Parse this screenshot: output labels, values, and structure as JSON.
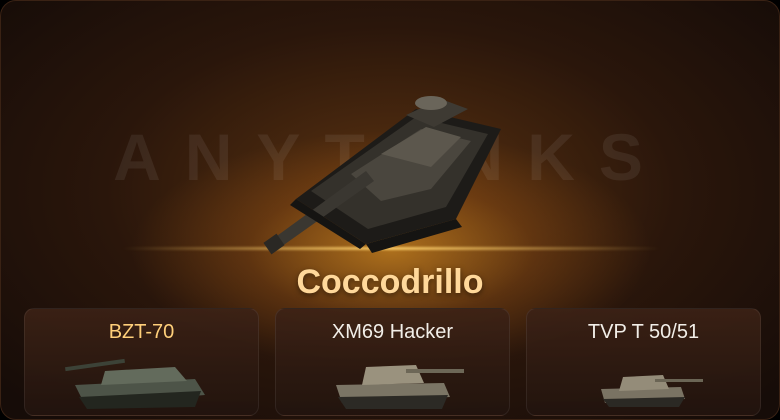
{
  "watermark": "ANYTANKS",
  "featured": {
    "name": "Coccodrillo"
  },
  "alternatives": [
    {
      "name": "BZT-70",
      "color": "#ffcf7a"
    },
    {
      "name": "XM69 Hacker",
      "color": "#f2eee8"
    },
    {
      "name": "TVP T 50/51",
      "color": "#f2eee8"
    }
  ]
}
